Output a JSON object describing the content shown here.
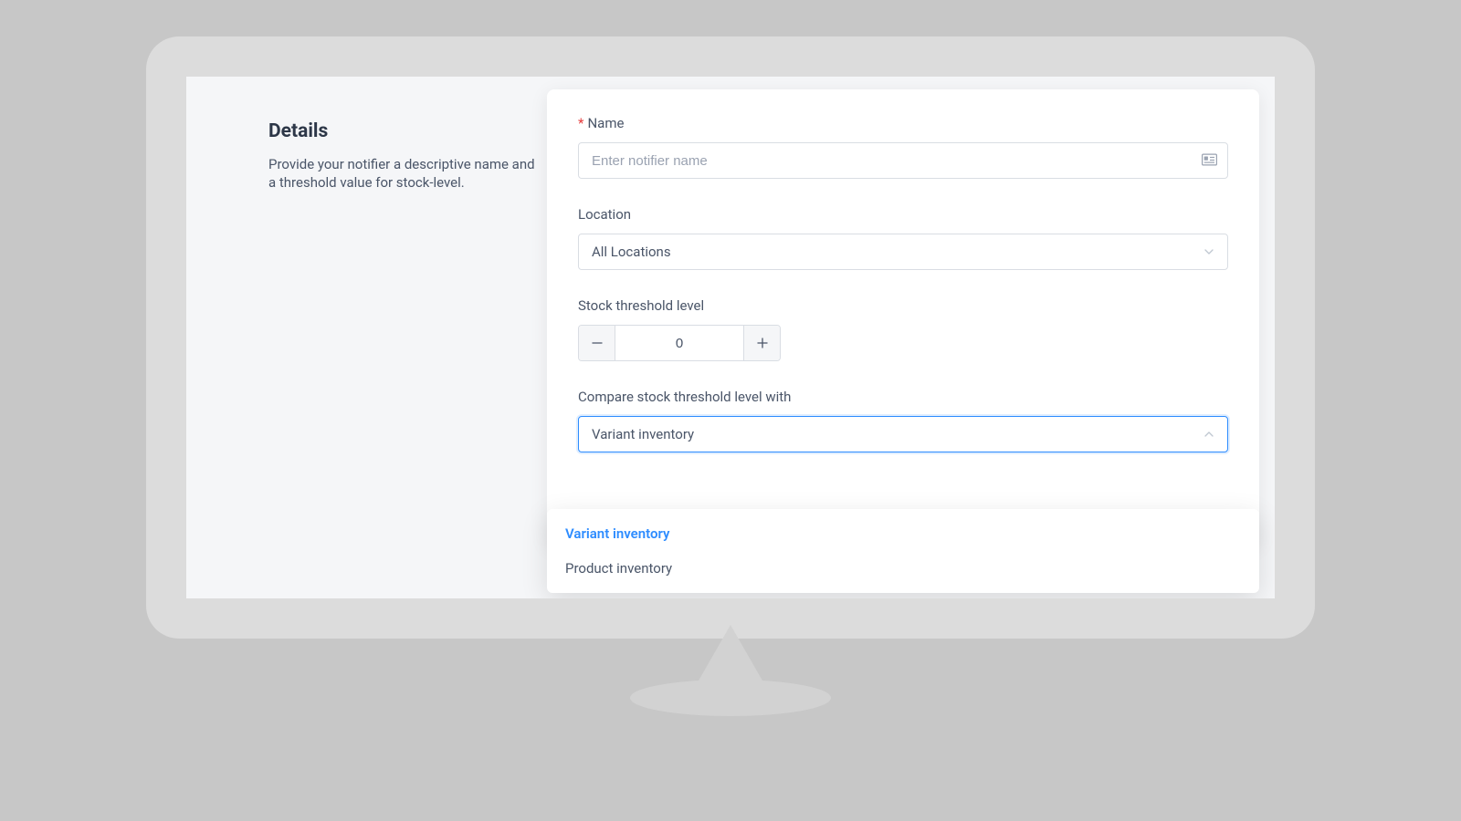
{
  "sidebar": {
    "title": "Details",
    "description": "Provide your notifier a descriptive name and a threshold value for stock-level."
  },
  "form": {
    "name": {
      "label": "Name",
      "required_mark": "*",
      "placeholder": "Enter notifier name",
      "value": ""
    },
    "location": {
      "label": "Location",
      "selected": "All Locations"
    },
    "threshold": {
      "label": "Stock threshold level",
      "value": "0"
    },
    "compare": {
      "label": "Compare stock threshold level with",
      "selected": "Variant inventory",
      "options": [
        "Variant inventory",
        "Product inventory"
      ]
    }
  }
}
